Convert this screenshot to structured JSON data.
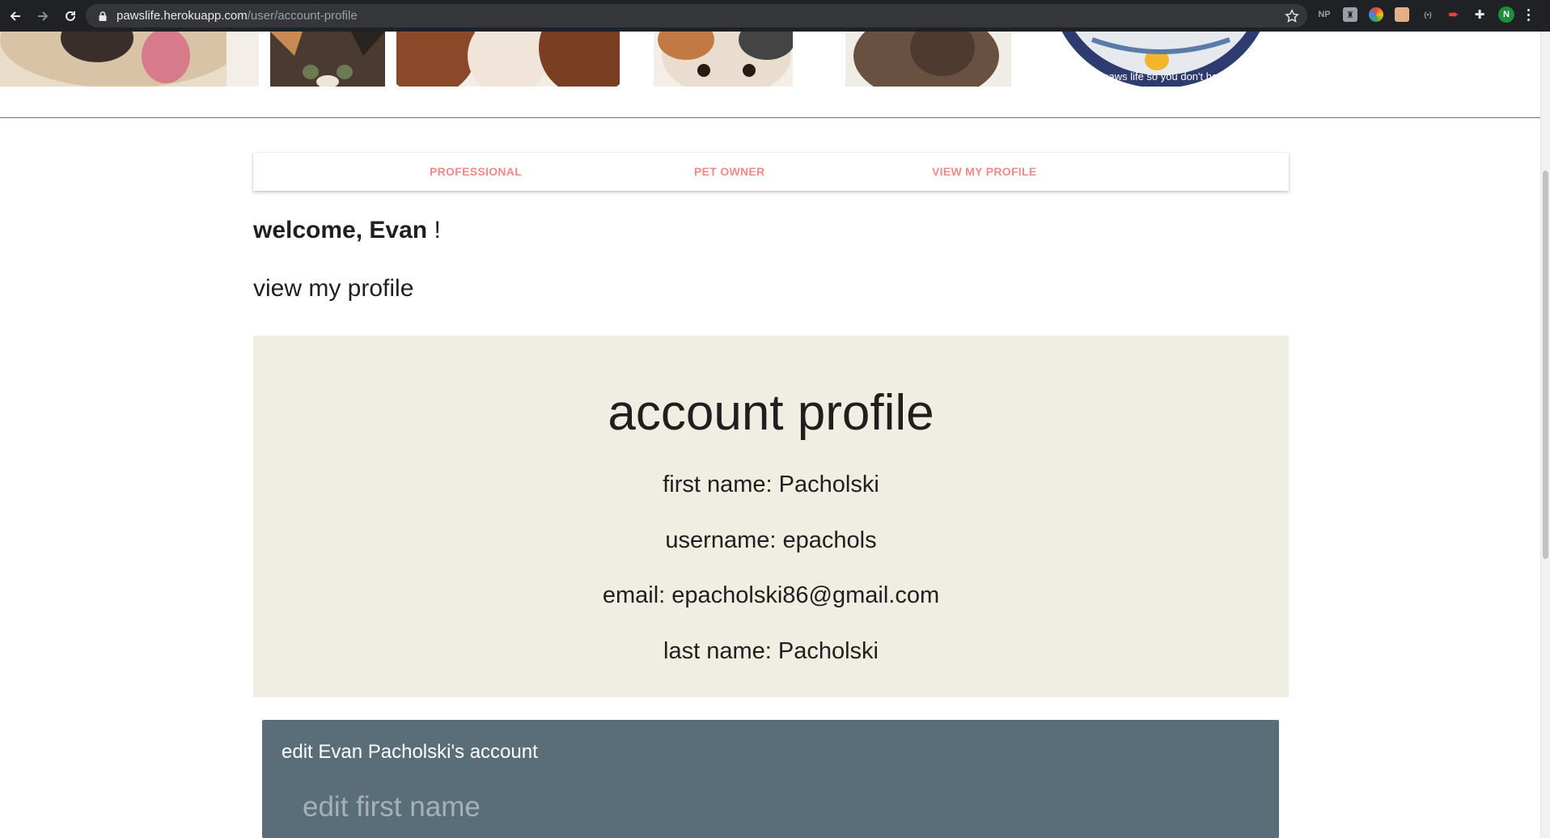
{
  "browser": {
    "url_host": "pawslife.herokuapp.com",
    "url_path": "/user/account-profile",
    "profile_initial": "N",
    "ext_np_label": "NP"
  },
  "banner": {
    "logo_text": "we paws life so you don't have to."
  },
  "tabs": [
    {
      "label": "PROFESSIONAL"
    },
    {
      "label": "PET OWNER"
    },
    {
      "label": "VIEW MY PROFILE"
    }
  ],
  "welcome": {
    "prefix": "welcome, Evan",
    "suffix": "!"
  },
  "view_profile_link": "view my profile",
  "profile": {
    "title": "account profile",
    "first_name": "first name: Pacholski",
    "username": "username: epachols",
    "email": "email: epacholski86@gmail.com",
    "last_name": "last name: Pacholski"
  },
  "edit": {
    "title": "edit Evan Pacholski's account",
    "first_name_placeholder": "edit first name"
  },
  "colors": {
    "tab_text": "#ee8a8a",
    "profile_bg": "#f0ede2",
    "edit_bg": "#5a6e7a"
  }
}
